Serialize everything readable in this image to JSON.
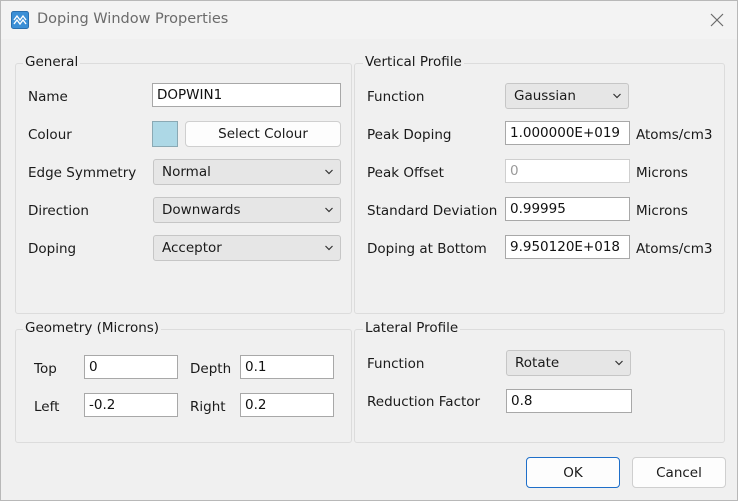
{
  "window": {
    "title": "Doping Window Properties",
    "accent_color": "#add8e6"
  },
  "general": {
    "title": "General",
    "name_label": "Name",
    "name_value": "DOPWIN1",
    "colour_label": "Colour",
    "colour_value": "#add8e6",
    "select_colour_label": "Select Colour",
    "edge_symmetry_label": "Edge Symmetry",
    "edge_symmetry_value": "Normal",
    "direction_label": "Direction",
    "direction_value": "Downwards",
    "doping_label": "Doping",
    "doping_value": "Acceptor"
  },
  "vertical": {
    "title": "Vertical Profile",
    "function_label": "Function",
    "function_value": "Gaussian",
    "peak_doping_label": "Peak Doping",
    "peak_doping_value": "1.000000E+019",
    "peak_doping_unit": "Atoms/cm3",
    "peak_offset_label": "Peak Offset",
    "peak_offset_value": "0",
    "peak_offset_unit": "Microns",
    "std_dev_label": "Standard Deviation",
    "std_dev_value": "0.99995",
    "std_dev_unit": "Microns",
    "doping_bottom_label": "Doping at Bottom",
    "doping_bottom_value": "9.950120E+018",
    "doping_bottom_unit": "Atoms/cm3"
  },
  "geometry": {
    "title": "Geometry (Microns)",
    "top_label": "Top",
    "top_value": "0",
    "depth_label": "Depth",
    "depth_value": "0.1",
    "left_label": "Left",
    "left_value": "-0.2",
    "right_label": "Right",
    "right_value": "0.2"
  },
  "lateral": {
    "title": "Lateral Profile",
    "function_label": "Function",
    "function_value": "Rotate",
    "reduction_label": "Reduction Factor",
    "reduction_value": "0.8"
  },
  "buttons": {
    "ok_label": "OK",
    "cancel_label": "Cancel"
  }
}
